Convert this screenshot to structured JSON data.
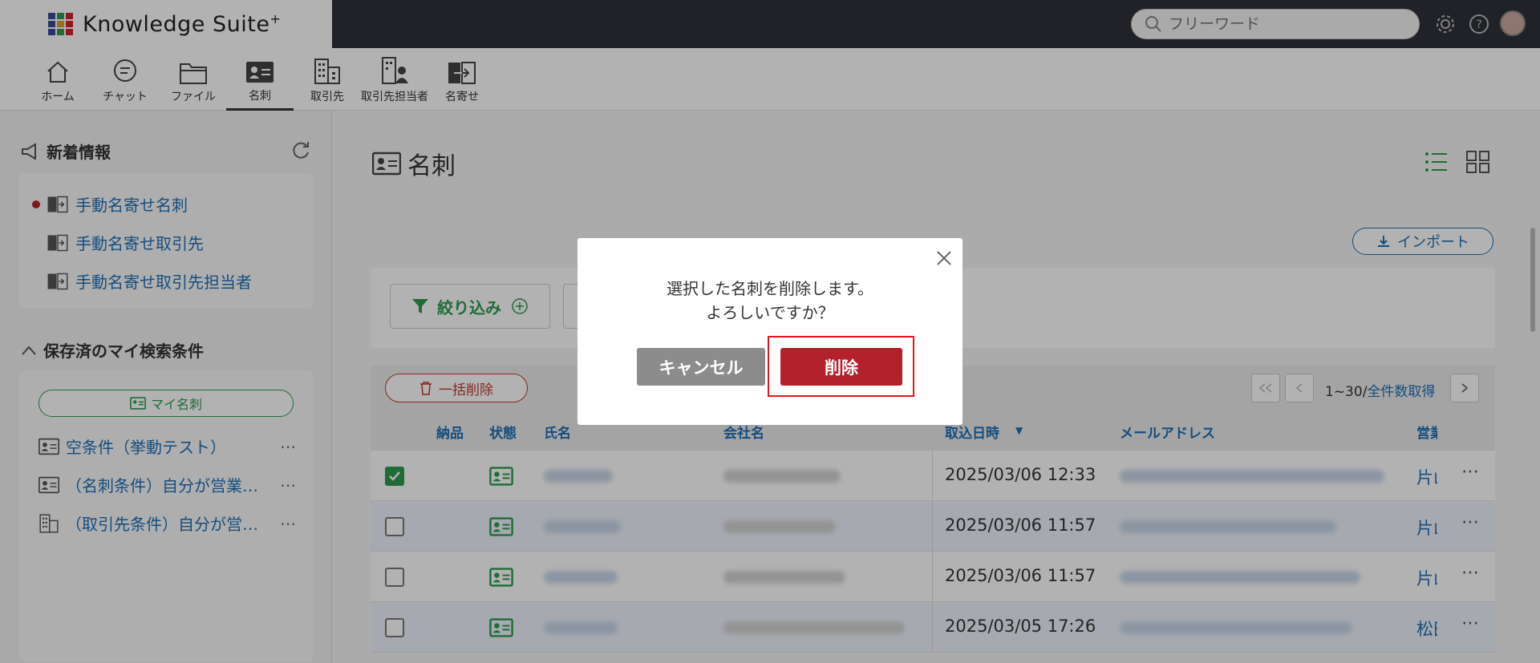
{
  "brand": {
    "name": "Knowledge Suite",
    "mark": "+",
    "colors": [
      "#3a4a9a",
      "#2d9b4e",
      "#d2232a",
      "#3a4a9a",
      "#e0a020",
      "#d2232a",
      "#3a4a9a",
      "#2d9b4e",
      "#d2232a"
    ]
  },
  "search": {
    "placeholder": "フリーワード"
  },
  "header_icons": [
    "settings-icon",
    "help-icon",
    "avatar"
  ],
  "nav": [
    {
      "label": "ホーム",
      "icon": "home-icon"
    },
    {
      "label": "チャット",
      "icon": "chat-icon"
    },
    {
      "label": "ファイル",
      "icon": "folder-icon"
    },
    {
      "label": "名刺",
      "icon": "business-card-icon",
      "active": true
    },
    {
      "label": "取引先",
      "icon": "building-icon"
    },
    {
      "label": "取引先担当者",
      "icon": "contact-person-icon"
    },
    {
      "label": "名寄せ",
      "icon": "merge-icon"
    }
  ],
  "left": {
    "news_title": "新着情報",
    "news_items": [
      {
        "label": "手動名寄せ名刺",
        "unread": true
      },
      {
        "label": "手動名寄せ取引先",
        "unread": false
      },
      {
        "label": "手動名寄せ取引先担当者",
        "unread": false
      }
    ],
    "saved_title": "保存済のマイ検索条件",
    "my_card_button": "マイ名刺",
    "saved_items": [
      {
        "label": "空条件（挙動テスト）",
        "icon": "business-card-icon"
      },
      {
        "label": "（名刺条件）自分が営業担当",
        "icon": "business-card-icon"
      },
      {
        "label": "（取引先条件）自分が営業担当",
        "icon": "building-icon"
      }
    ],
    "more": "⋯"
  },
  "main": {
    "title": "名刺",
    "import_label": "インポート",
    "filter_label": "絞り込み",
    "bulk_delete_label": "一括削除",
    "pager": {
      "range": "1~30/",
      "total_link": "全件数取得"
    },
    "columns": [
      "納品",
      "状態",
      "氏名",
      "会社名",
      "取込日時",
      "メールアドレス",
      "営業"
    ],
    "sort_indicator": "▼",
    "rows": [
      {
        "checked": true,
        "date": "2025/03/06 12:33",
        "owner": "片山"
      },
      {
        "checked": false,
        "date": "2025/03/06 11:57",
        "owner": "片山"
      },
      {
        "checked": false,
        "date": "2025/03/06 11:57",
        "owner": "片山"
      },
      {
        "checked": false,
        "date": "2025/03/05 17:26",
        "owner": "松田"
      }
    ]
  },
  "dialog": {
    "message_line1": "選択した名刺を削除します。",
    "message_line2": "よろしいですか？",
    "cancel_label": "キャンセル",
    "delete_label": "削除"
  }
}
